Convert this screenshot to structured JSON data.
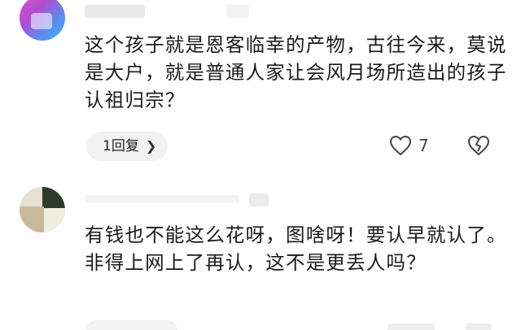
{
  "comments": [
    {
      "text": "这个孩子就是恩客临幸的产物，古往今来，莫说是大户，就是普通人家让会风月场所造出的孩子认祖归宗？",
      "reply_label": "1回复",
      "like_count": "7"
    },
    {
      "text": "有钱也不能这么花呀，图啥呀！要认早就认了。非得上网上了再认，这不是更丢人吗？",
      "reply_label": "",
      "like_count": ""
    }
  ],
  "icons": {
    "chevron": "chevron-right-icon",
    "like": "heart-icon",
    "dislike": "broken-heart-icon"
  },
  "colors": {
    "text": "#1a1a1a",
    "reply_bg": "#f2f2f2",
    "icon": "#444444"
  }
}
